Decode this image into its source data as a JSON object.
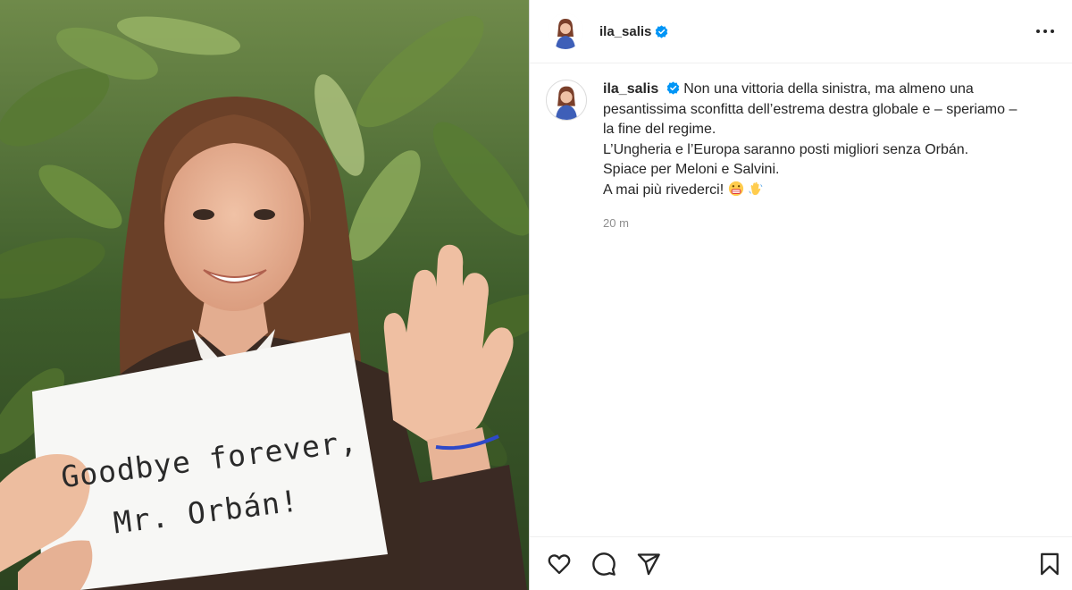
{
  "post": {
    "username": "ila_salis",
    "verified": true,
    "caption_lines": [
      "Non una vittoria della sinistra, ma almeno una",
      "pesantissima sconfitta dell’estrema destra globale e – speriamo –",
      "la fine del regime.",
      "L’Ungheria e l’Europa saranno posti migliori senza Orbán.",
      "Spiace per Meloni e Salvini.",
      "A mai più rivederci!"
    ],
    "timestamp": "20 m",
    "sign_text_line1": "Goodbye forever,",
    "sign_text_line2": "Mr. Orbán!"
  },
  "icons": {
    "more": "more-horizontal-icon",
    "like": "heart-icon",
    "comment": "comment-icon",
    "share": "paper-plane-icon",
    "save": "bookmark-icon",
    "verified": "verified-badge-icon"
  },
  "colors": {
    "verified_blue": "#0095f6",
    "text": "#262626",
    "muted": "#8e8e8e",
    "divider": "#dbdbdb"
  }
}
